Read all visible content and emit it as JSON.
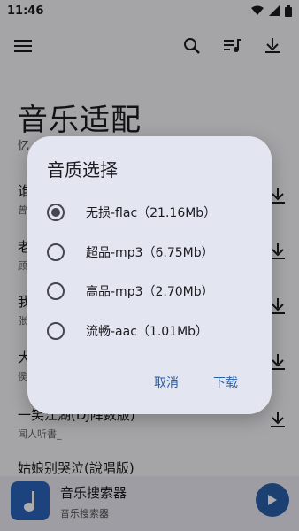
{
  "status": {
    "time": "11:46"
  },
  "header": {
    "title": "音乐适配",
    "subtitle": "忆"
  },
  "songs": [
    {
      "title": "谁",
      "artist": "曾"
    },
    {
      "title": "老",
      "artist": "顾"
    },
    {
      "title": "我",
      "artist": "张"
    },
    {
      "title": "大",
      "artist": "侯"
    },
    {
      "title": "一笑江湖(DJ降数版)",
      "artist": "闻人听書_"
    },
    {
      "title": "姑娘别哭泣(說唱版)",
      "artist": ""
    }
  ],
  "player": {
    "title": "音乐搜索器",
    "subtitle": "音乐搜索器"
  },
  "dialog": {
    "title": "音质选择",
    "options": [
      {
        "label": "无损-flac（21.16Mb）",
        "selected": true
      },
      {
        "label": "超品-mp3（6.75Mb）",
        "selected": false
      },
      {
        "label": "高品-mp3（2.70Mb）",
        "selected": false
      },
      {
        "label": "流畅-aac（1.01Mb）",
        "selected": false
      }
    ],
    "cancel": "取消",
    "confirm": "下载"
  },
  "colors": {
    "accent": "#2a5fa8",
    "dialog_bg": "#e3e6f1"
  }
}
